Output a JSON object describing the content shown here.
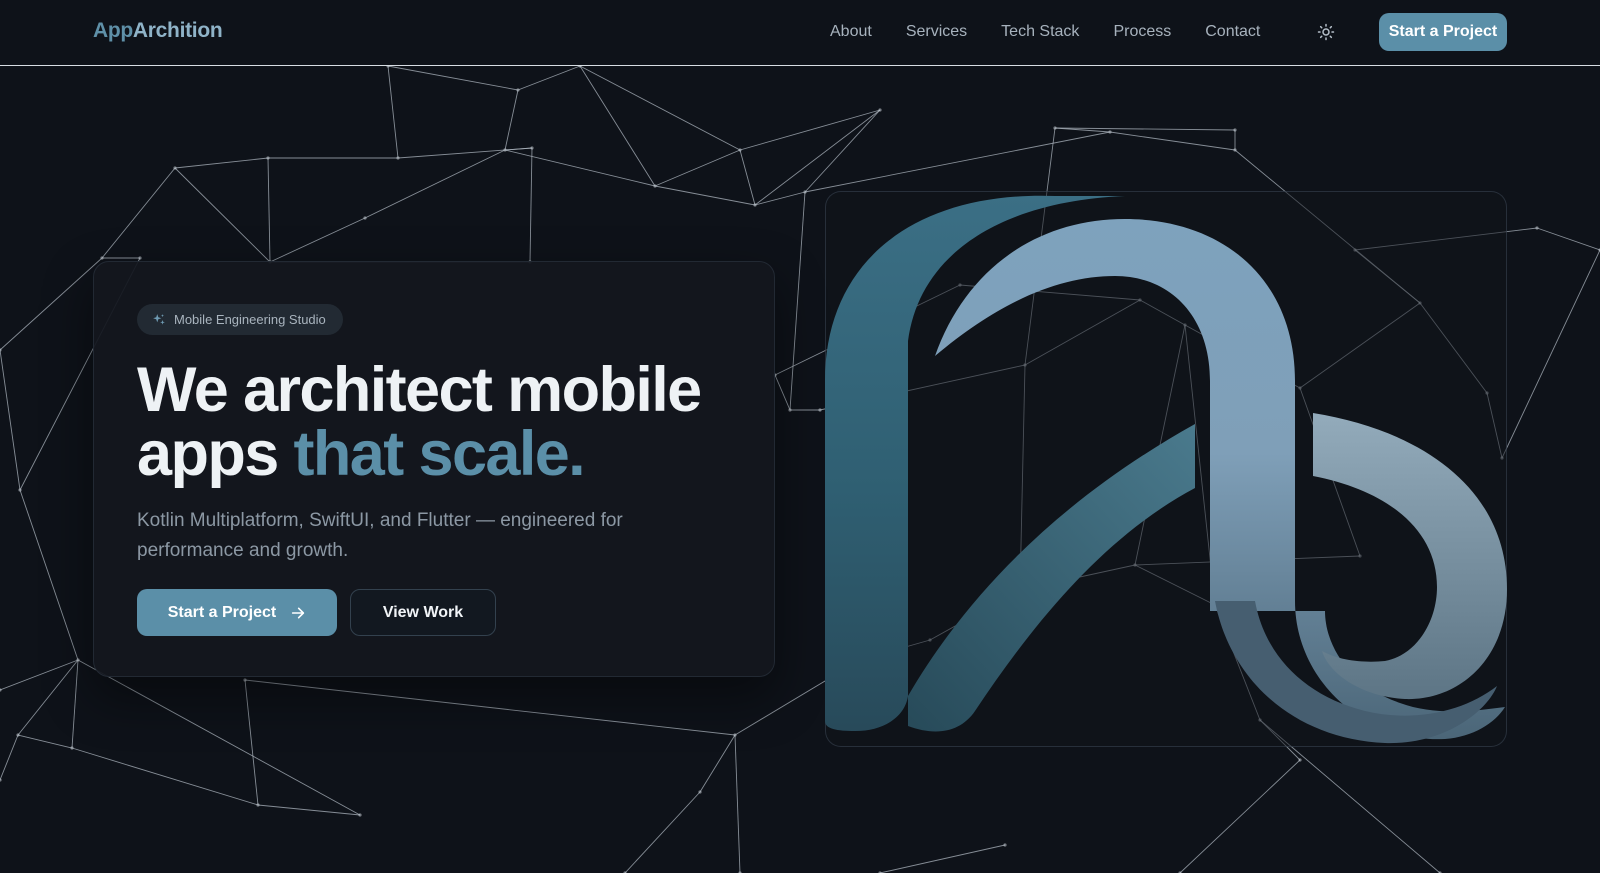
{
  "brand": {
    "part1": "App",
    "part2": "Archition",
    "color": "#5b8fa8"
  },
  "nav": {
    "items": [
      {
        "label": "About"
      },
      {
        "label": "Services"
      },
      {
        "label": "Tech Stack"
      },
      {
        "label": "Process"
      },
      {
        "label": "Contact"
      }
    ],
    "theme_toggle_icon": "sun-icon",
    "cta_label": "Start a Project"
  },
  "hero": {
    "badge": {
      "icon": "sparkle-icon",
      "label": "Mobile Engineering Studio"
    },
    "headline_line1": "We architect mobile",
    "headline_line2_plain": "apps ",
    "headline_line2_accent": "that scale.",
    "subtitle": "Kotlin Multiplatform, SwiftUI, and Flutter — engineered for performance and growth.",
    "primary_button": {
      "label": "Start a Project",
      "icon": "arrow-right-icon"
    },
    "secondary_button": {
      "label": "View Work"
    }
  },
  "colors": {
    "background": "#0e1219",
    "accent": "#5b8fa8",
    "card": "#13171e",
    "text": "#eef2f5",
    "muted": "#8c98a4"
  }
}
